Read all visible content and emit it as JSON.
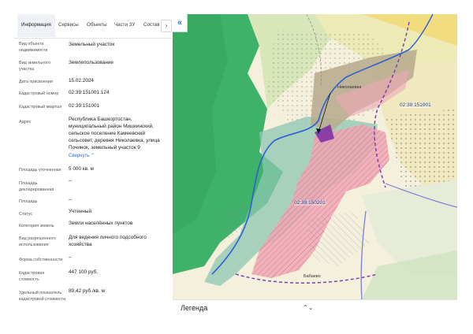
{
  "tabs": [
    {
      "label": "Информация"
    },
    {
      "label": "Сервисы"
    },
    {
      "label": "Объекты"
    },
    {
      "label": "Части ЗУ"
    },
    {
      "label": "Состав"
    }
  ],
  "tabs_arrow": "›",
  "info": [
    {
      "label": "Вид объекта недвижимости",
      "value": "Земельный участок"
    },
    {
      "label": "Вид земельного участка",
      "value": "Землепользование"
    },
    {
      "label": "Дата присвоения",
      "value": "15.02.2024"
    },
    {
      "label": "Кадастровый номер",
      "value": "02:39:151001:124"
    },
    {
      "label": "Кадастровый квартал",
      "value": "02:39:151001"
    },
    {
      "label": "Адрес",
      "value": "Республика Башкортостан, муниципальный район Мишкинский, сельское поселение Камеевский сельсовет, деревня Николаевка, улица Починок, земельный участок 9"
    },
    {
      "label": "Площадь уточненная",
      "value": "5 000 кв. м"
    },
    {
      "label": "Площадь декларированная",
      "value": "–"
    },
    {
      "label": "Площадь",
      "value": "–"
    },
    {
      "label": "Статус",
      "value": "Учтенный"
    },
    {
      "label": "Категория земель",
      "value": "Земли населённых пунктов"
    },
    {
      "label": "Вид разрешенного использования",
      "value": "Для ведения личного подсобного хозяйства"
    },
    {
      "label": "Форма собственности",
      "value": "–"
    },
    {
      "label": "Кадастровая стоимость",
      "value": "447 100 руб."
    },
    {
      "label": "Удельный показатель кадастровой стоимости",
      "value": "89,42 руб./кв. м"
    }
  ],
  "address_toggle": "Свернуть",
  "map": {
    "collapse_icon": "«",
    "labels": {
      "quarter_north": "02:39:151001",
      "quarter_center": "02:39:150201",
      "village_north": "Николаевка",
      "village_south": "Бабаево"
    },
    "legend_label": "Легенда",
    "legend_chevron": "⌃⌄"
  }
}
